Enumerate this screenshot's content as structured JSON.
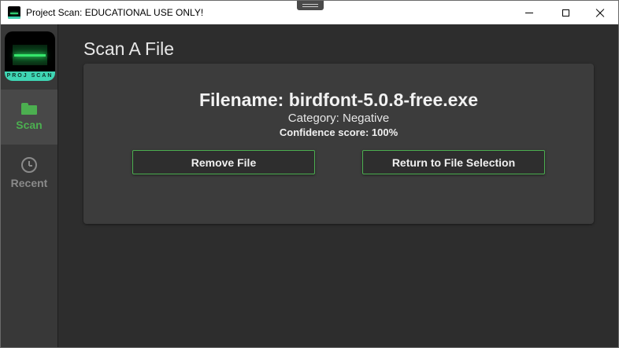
{
  "window": {
    "title": "Project Scan: EDUCATIONAL USE ONLY!",
    "controls": [
      "minimize",
      "maximize",
      "close"
    ]
  },
  "sidebar": {
    "logo_text": "PROJ SCAN",
    "items": [
      {
        "label": "Scan",
        "icon": "folder-icon",
        "active": true
      },
      {
        "label": "Recent",
        "icon": "clock-icon",
        "active": false
      }
    ]
  },
  "main": {
    "title": "Scan A File",
    "result": {
      "filename": "Filename: birdfont-5.0.8-free.exe",
      "category": "Category: Negative",
      "confidence": "Confidence score: 100%"
    },
    "buttons": {
      "remove": "Remove File",
      "return": "Return to File Selection"
    }
  },
  "colors": {
    "accent": "#4caf50",
    "background": "#2d2d2d",
    "card": "#3c3c3c",
    "sidebar": "#383838"
  }
}
